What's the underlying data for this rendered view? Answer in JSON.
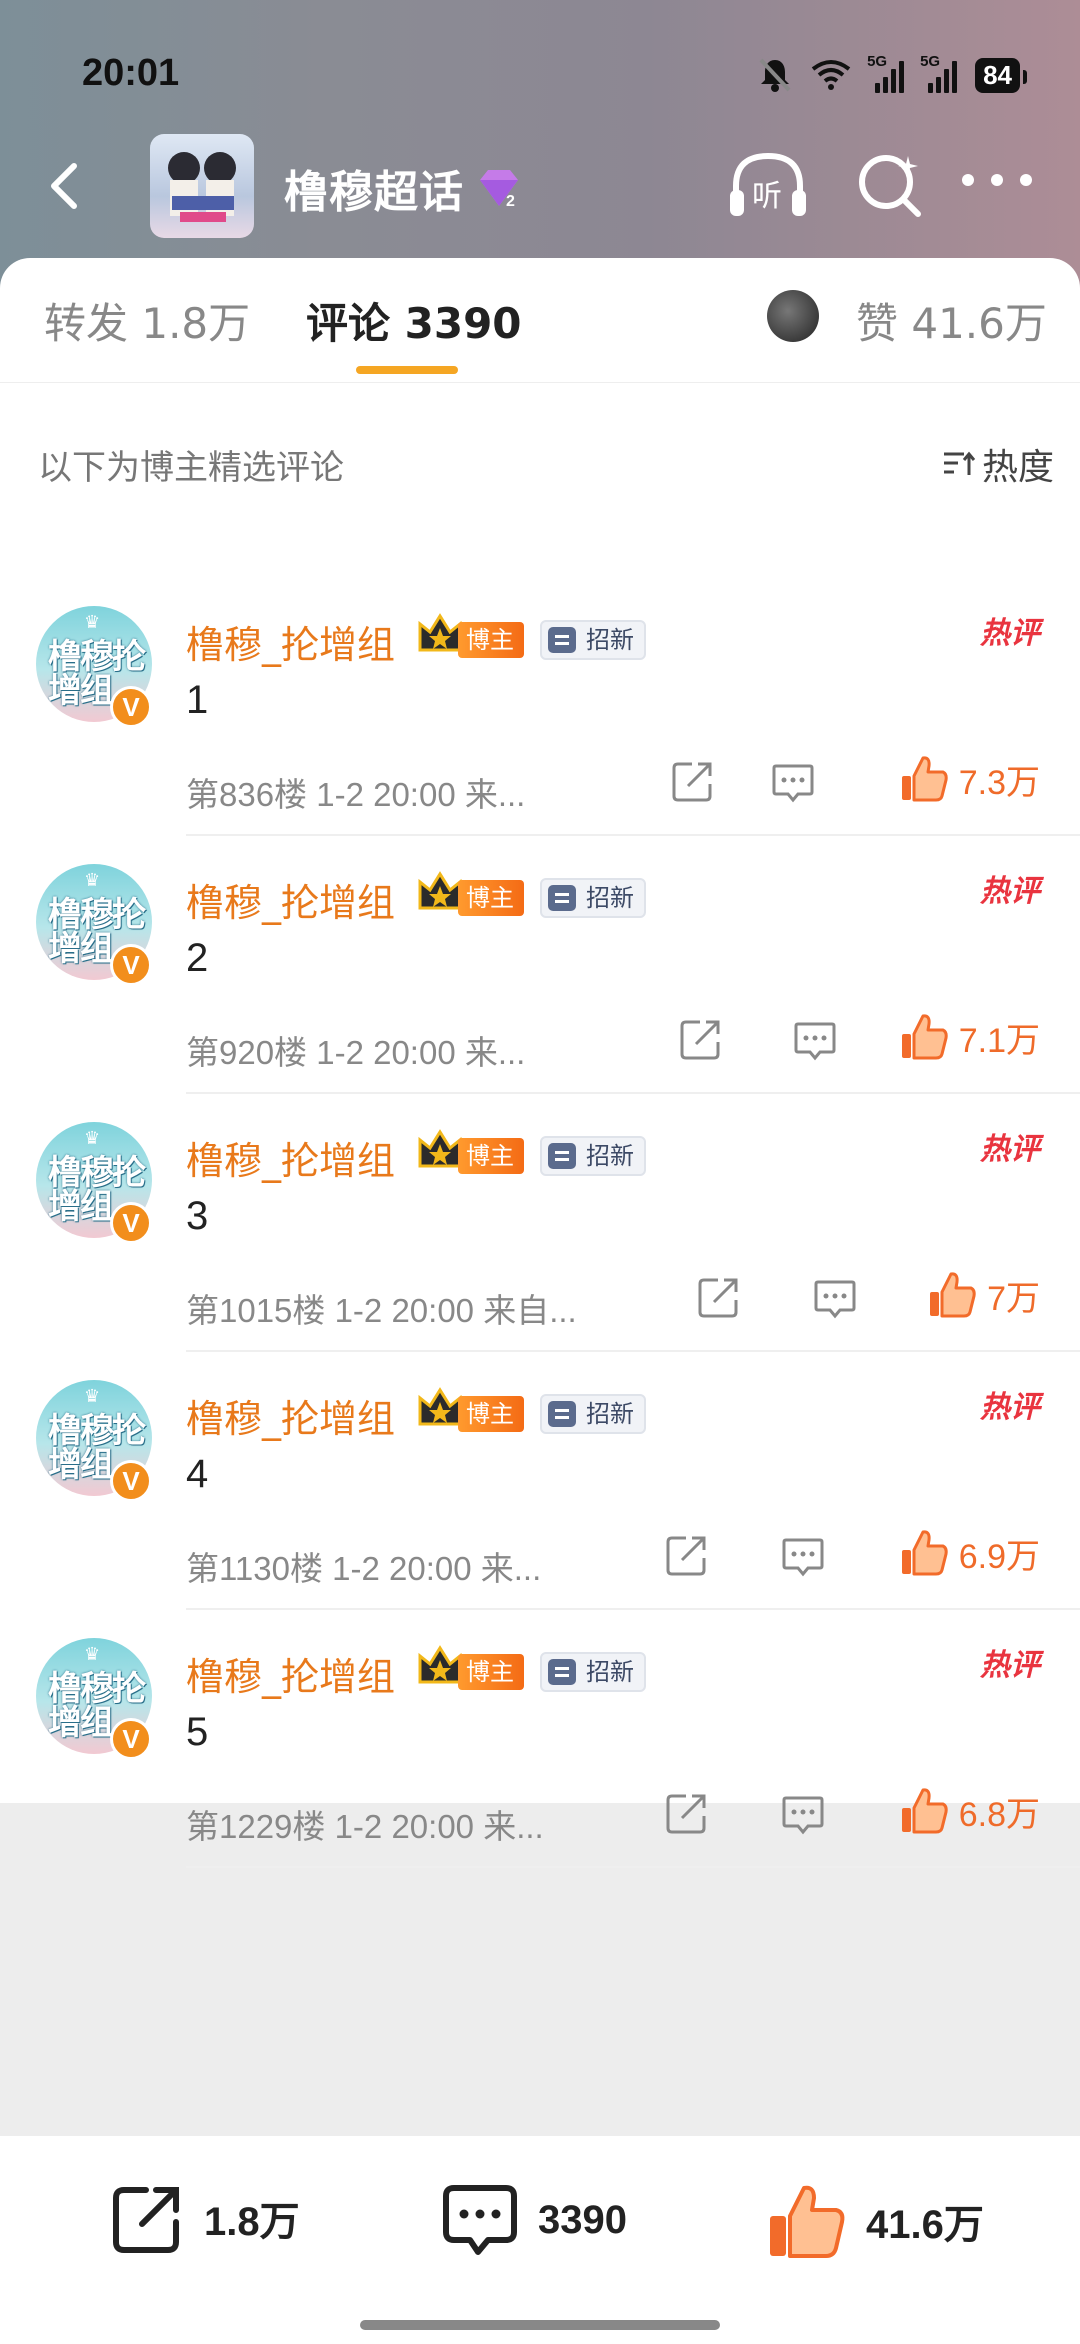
{
  "status": {
    "time": "20:01",
    "battery": "84",
    "network_a": "5G",
    "network_b": "5G"
  },
  "nav": {
    "title": "橹穆超话",
    "listen_label": "听"
  },
  "tabs": {
    "repost": "转发 1.8万",
    "comment": "评论 3390",
    "likes": "赞 41.6万"
  },
  "section": {
    "heading": "以下为博主精选评论",
    "sort_label": "热度"
  },
  "comments": [
    {
      "user": "橹穆_抡增组",
      "role_tag": "博主",
      "tag": "招新",
      "hot": "热评",
      "text": "1",
      "meta": "第836楼 1-2 20:00 来...",
      "likes": "7.3万"
    },
    {
      "user": "橹穆_抡增组",
      "role_tag": "博主",
      "tag": "招新",
      "hot": "热评",
      "text": "2",
      "meta": "第920楼 1-2 20:00 来...",
      "likes": "7.1万"
    },
    {
      "user": "橹穆_抡增组",
      "role_tag": "博主",
      "tag": "招新",
      "hot": "热评",
      "text": "3",
      "meta": "第1015楼 1-2 20:00 来自...",
      "likes": "7万"
    },
    {
      "user": "橹穆_抡增组",
      "role_tag": "博主",
      "tag": "招新",
      "hot": "热评",
      "text": "4",
      "meta": "第1130楼 1-2 20:00 来...",
      "likes": "6.9万"
    },
    {
      "user": "橹穆_抡增组",
      "role_tag": "博主",
      "tag": "招新",
      "hot": "热评",
      "text": "5",
      "meta": "第1229楼 1-2 20:00 来...",
      "likes": "6.8万"
    }
  ],
  "avatar_text": "橹穆抡增组",
  "bottom": {
    "repost": "1.8万",
    "comment": "3390",
    "like": "41.6万"
  },
  "colors": {
    "accent_orange": "#e8791b",
    "tab_indicator": "#f5a623",
    "hot_red": "#e9343f",
    "like_orange": "#ef6b2a"
  }
}
